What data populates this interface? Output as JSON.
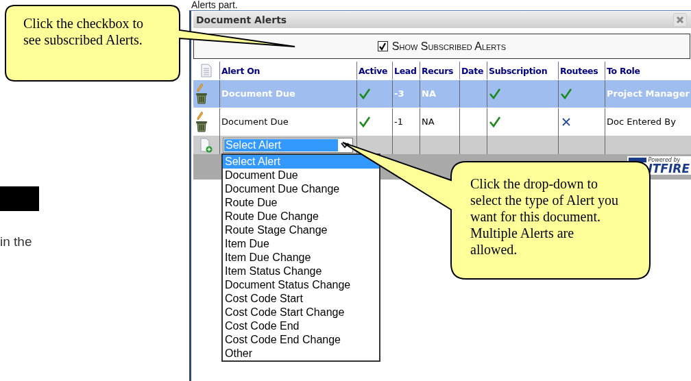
{
  "document": {
    "heading": "Alerts part.",
    "side_text": "in the"
  },
  "panel": {
    "title": "Document Alerts",
    "show_subscribed": {
      "label": "Show Subscribed Alerts",
      "checked": true
    },
    "table": {
      "columns": [
        "Alert On",
        "Active",
        "Lead",
        "Recurs",
        "Date",
        "Subscription",
        "Routees",
        "To Role"
      ],
      "rows": [
        {
          "selected": true,
          "alert_on": "Document Due",
          "active": true,
          "lead": "-3",
          "recurs": "NA",
          "subscription": true,
          "routees": true,
          "to_role": "Project Manager"
        },
        {
          "selected": false,
          "alert_on": "Document Due",
          "active": true,
          "lead": "-1",
          "recurs": "NA",
          "subscription": true,
          "routees": false,
          "to_role": "Doc Entered By"
        }
      ]
    },
    "new_alert": {
      "value": "Select Alert"
    },
    "dropdown": {
      "options": [
        {
          "label": "Select Alert",
          "selected": true
        },
        {
          "label": "Document Due",
          "selected": false
        },
        {
          "label": "Document Due Change",
          "selected": false
        },
        {
          "label": "Route Due",
          "selected": false
        },
        {
          "label": "Route Due Change",
          "selected": false
        },
        {
          "label": "Route Stage Change",
          "selected": false
        },
        {
          "label": "Item Due",
          "selected": false
        },
        {
          "label": "Item Due Change",
          "selected": false
        },
        {
          "label": "Item Status Change",
          "selected": false
        },
        {
          "label": "Document Status Change",
          "selected": false
        },
        {
          "label": "Cost Code Start",
          "selected": false
        },
        {
          "label": "Cost Code Start Change",
          "selected": false
        },
        {
          "label": "Cost Code End",
          "selected": false
        },
        {
          "label": "Cost Code End Change",
          "selected": false
        },
        {
          "label": "Other",
          "selected": false
        }
      ]
    },
    "logo": {
      "caption": "Powered by",
      "name": "ITFIRE"
    }
  },
  "callouts": [
    {
      "text": "Click the checkbox to see subscribed Alerts."
    },
    {
      "text": "Click the drop-down to select the type of Alert you want for this document.  Multiple Alerts are allowed."
    }
  ]
}
